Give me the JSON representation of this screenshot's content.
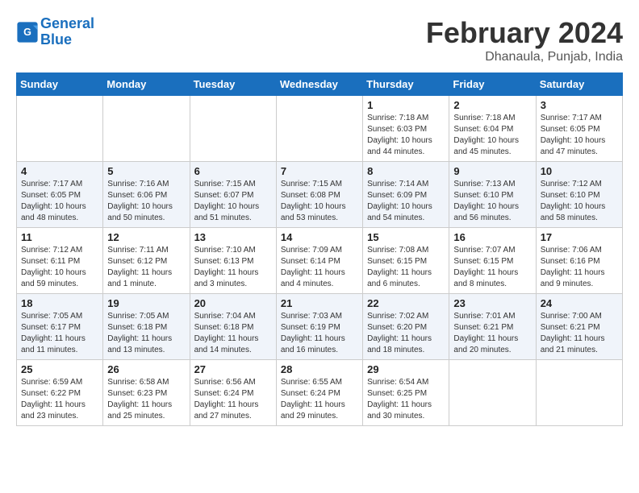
{
  "header": {
    "logo_line1": "General",
    "logo_line2": "Blue",
    "main_title": "February 2024",
    "subtitle": "Dhanaula, Punjab, India"
  },
  "days_of_week": [
    "Sunday",
    "Monday",
    "Tuesday",
    "Wednesday",
    "Thursday",
    "Friday",
    "Saturday"
  ],
  "weeks": [
    [
      {
        "day": "",
        "sunrise": "",
        "sunset": "",
        "daylight": "",
        "empty": true
      },
      {
        "day": "",
        "sunrise": "",
        "sunset": "",
        "daylight": "",
        "empty": true
      },
      {
        "day": "",
        "sunrise": "",
        "sunset": "",
        "daylight": "",
        "empty": true
      },
      {
        "day": "",
        "sunrise": "",
        "sunset": "",
        "daylight": "",
        "empty": true
      },
      {
        "day": "1",
        "sunrise": "Sunrise: 7:18 AM",
        "sunset": "Sunset: 6:03 PM",
        "daylight": "Daylight: 10 hours and 44 minutes."
      },
      {
        "day": "2",
        "sunrise": "Sunrise: 7:18 AM",
        "sunset": "Sunset: 6:04 PM",
        "daylight": "Daylight: 10 hours and 45 minutes."
      },
      {
        "day": "3",
        "sunrise": "Sunrise: 7:17 AM",
        "sunset": "Sunset: 6:05 PM",
        "daylight": "Daylight: 10 hours and 47 minutes."
      }
    ],
    [
      {
        "day": "4",
        "sunrise": "Sunrise: 7:17 AM",
        "sunset": "Sunset: 6:05 PM",
        "daylight": "Daylight: 10 hours and 48 minutes."
      },
      {
        "day": "5",
        "sunrise": "Sunrise: 7:16 AM",
        "sunset": "Sunset: 6:06 PM",
        "daylight": "Daylight: 10 hours and 50 minutes."
      },
      {
        "day": "6",
        "sunrise": "Sunrise: 7:15 AM",
        "sunset": "Sunset: 6:07 PM",
        "daylight": "Daylight: 10 hours and 51 minutes."
      },
      {
        "day": "7",
        "sunrise": "Sunrise: 7:15 AM",
        "sunset": "Sunset: 6:08 PM",
        "daylight": "Daylight: 10 hours and 53 minutes."
      },
      {
        "day": "8",
        "sunrise": "Sunrise: 7:14 AM",
        "sunset": "Sunset: 6:09 PM",
        "daylight": "Daylight: 10 hours and 54 minutes."
      },
      {
        "day": "9",
        "sunrise": "Sunrise: 7:13 AM",
        "sunset": "Sunset: 6:10 PM",
        "daylight": "Daylight: 10 hours and 56 minutes."
      },
      {
        "day": "10",
        "sunrise": "Sunrise: 7:12 AM",
        "sunset": "Sunset: 6:10 PM",
        "daylight": "Daylight: 10 hours and 58 minutes."
      }
    ],
    [
      {
        "day": "11",
        "sunrise": "Sunrise: 7:12 AM",
        "sunset": "Sunset: 6:11 PM",
        "daylight": "Daylight: 10 hours and 59 minutes."
      },
      {
        "day": "12",
        "sunrise": "Sunrise: 7:11 AM",
        "sunset": "Sunset: 6:12 PM",
        "daylight": "Daylight: 11 hours and 1 minute."
      },
      {
        "day": "13",
        "sunrise": "Sunrise: 7:10 AM",
        "sunset": "Sunset: 6:13 PM",
        "daylight": "Daylight: 11 hours and 3 minutes."
      },
      {
        "day": "14",
        "sunrise": "Sunrise: 7:09 AM",
        "sunset": "Sunset: 6:14 PM",
        "daylight": "Daylight: 11 hours and 4 minutes."
      },
      {
        "day": "15",
        "sunrise": "Sunrise: 7:08 AM",
        "sunset": "Sunset: 6:15 PM",
        "daylight": "Daylight: 11 hours and 6 minutes."
      },
      {
        "day": "16",
        "sunrise": "Sunrise: 7:07 AM",
        "sunset": "Sunset: 6:15 PM",
        "daylight": "Daylight: 11 hours and 8 minutes."
      },
      {
        "day": "17",
        "sunrise": "Sunrise: 7:06 AM",
        "sunset": "Sunset: 6:16 PM",
        "daylight": "Daylight: 11 hours and 9 minutes."
      }
    ],
    [
      {
        "day": "18",
        "sunrise": "Sunrise: 7:05 AM",
        "sunset": "Sunset: 6:17 PM",
        "daylight": "Daylight: 11 hours and 11 minutes."
      },
      {
        "day": "19",
        "sunrise": "Sunrise: 7:05 AM",
        "sunset": "Sunset: 6:18 PM",
        "daylight": "Daylight: 11 hours and 13 minutes."
      },
      {
        "day": "20",
        "sunrise": "Sunrise: 7:04 AM",
        "sunset": "Sunset: 6:18 PM",
        "daylight": "Daylight: 11 hours and 14 minutes."
      },
      {
        "day": "21",
        "sunrise": "Sunrise: 7:03 AM",
        "sunset": "Sunset: 6:19 PM",
        "daylight": "Daylight: 11 hours and 16 minutes."
      },
      {
        "day": "22",
        "sunrise": "Sunrise: 7:02 AM",
        "sunset": "Sunset: 6:20 PM",
        "daylight": "Daylight: 11 hours and 18 minutes."
      },
      {
        "day": "23",
        "sunrise": "Sunrise: 7:01 AM",
        "sunset": "Sunset: 6:21 PM",
        "daylight": "Daylight: 11 hours and 20 minutes."
      },
      {
        "day": "24",
        "sunrise": "Sunrise: 7:00 AM",
        "sunset": "Sunset: 6:21 PM",
        "daylight": "Daylight: 11 hours and 21 minutes."
      }
    ],
    [
      {
        "day": "25",
        "sunrise": "Sunrise: 6:59 AM",
        "sunset": "Sunset: 6:22 PM",
        "daylight": "Daylight: 11 hours and 23 minutes."
      },
      {
        "day": "26",
        "sunrise": "Sunrise: 6:58 AM",
        "sunset": "Sunset: 6:23 PM",
        "daylight": "Daylight: 11 hours and 25 minutes."
      },
      {
        "day": "27",
        "sunrise": "Sunrise: 6:56 AM",
        "sunset": "Sunset: 6:24 PM",
        "daylight": "Daylight: 11 hours and 27 minutes."
      },
      {
        "day": "28",
        "sunrise": "Sunrise: 6:55 AM",
        "sunset": "Sunset: 6:24 PM",
        "daylight": "Daylight: 11 hours and 29 minutes."
      },
      {
        "day": "29",
        "sunrise": "Sunrise: 6:54 AM",
        "sunset": "Sunset: 6:25 PM",
        "daylight": "Daylight: 11 hours and 30 minutes."
      },
      {
        "day": "",
        "sunrise": "",
        "sunset": "",
        "daylight": "",
        "empty": true
      },
      {
        "day": "",
        "sunrise": "",
        "sunset": "",
        "daylight": "",
        "empty": true
      }
    ]
  ]
}
